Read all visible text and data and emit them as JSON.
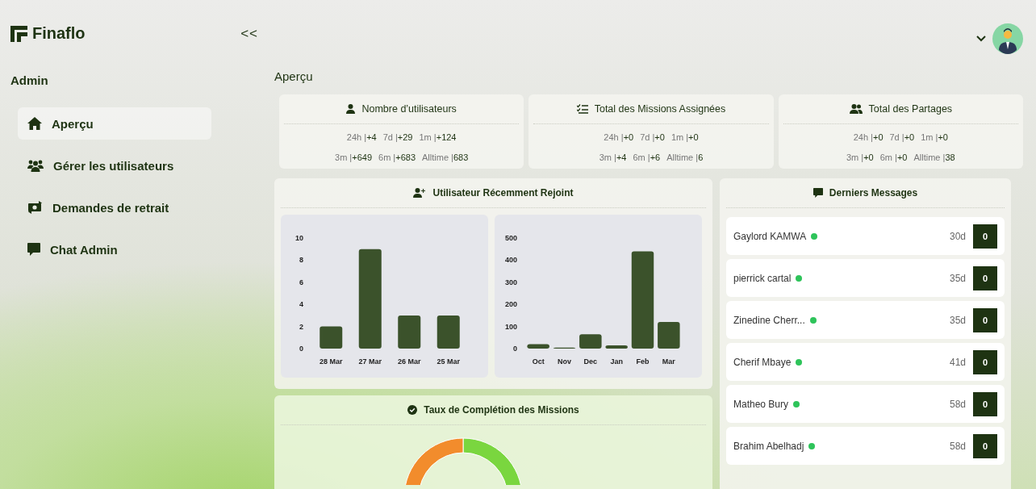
{
  "brand": {
    "name": "Finaflo",
    "collapse": "<<"
  },
  "sidebar": {
    "section": "Admin",
    "items": [
      {
        "label": "Aperçu",
        "selected": true
      },
      {
        "label": "Gérer les utilisateurs",
        "selected": false
      },
      {
        "label": "Demandes de retrait",
        "selected": false
      },
      {
        "label": "Chat Admin",
        "selected": false
      }
    ]
  },
  "page_title": "Aperçu",
  "stats": [
    {
      "title": "Nombre d’utilisateurs",
      "rows": [
        [
          {
            "label": "24h |",
            "value": "+4"
          },
          {
            "label": "7d |",
            "value": "+29"
          },
          {
            "label": "1m |",
            "value": "+124"
          }
        ],
        [
          {
            "label": "3m |",
            "value": "+649"
          },
          {
            "label": "6m |",
            "value": "+683"
          },
          {
            "label": "Alltime |",
            "value": "683"
          }
        ]
      ]
    },
    {
      "title": "Total des Missions Assignées",
      "rows": [
        [
          {
            "label": "24h |",
            "value": "+0"
          },
          {
            "label": "7d |",
            "value": "+0"
          },
          {
            "label": "1m |",
            "value": "+0"
          }
        ],
        [
          {
            "label": "3m |",
            "value": "+4"
          },
          {
            "label": "6m |",
            "value": "+6"
          },
          {
            "label": "Alltime |",
            "value": "6"
          }
        ]
      ]
    },
    {
      "title": "Total des Partages",
      "rows": [
        [
          {
            "label": "24h |",
            "value": "+0"
          },
          {
            "label": "7d |",
            "value": "+0"
          },
          {
            "label": "1m |",
            "value": "+0"
          }
        ],
        [
          {
            "label": "3m |",
            "value": "+0"
          },
          {
            "label": "6m |",
            "value": "+0"
          },
          {
            "label": "Alltime |",
            "value": "38"
          }
        ]
      ]
    }
  ],
  "joined": {
    "title": "Utilisateur Récemment Rejoint",
    "charts": [
      {
        "chart_data": {
          "type": "bar",
          "categories": [
            "28 Mar",
            "27 Mar",
            "26 Mar",
            "25 Mar"
          ],
          "series": [
            {
              "color": "#3b522b",
              "values": [
                2,
                9,
                3,
                3
              ]
            }
          ],
          "ylim": [
            0,
            10
          ],
          "yticks": [
            0,
            2,
            4,
            6,
            8,
            10
          ]
        }
      },
      {
        "chart_data": {
          "type": "bar",
          "categories": [
            "Oct",
            "Nov",
            "Dec",
            "Jan",
            "Feb",
            "Mar"
          ],
          "series": [
            {
              "color": "#3b522b",
              "values": [
                20,
                5,
                65,
                15,
                440,
                120
              ]
            }
          ],
          "ylim": [
            0,
            500
          ],
          "yticks": [
            0,
            100,
            200,
            300,
            400,
            500
          ]
        }
      }
    ]
  },
  "completion": {
    "title": "Taux de Complétion des Missions"
  },
  "messages": {
    "title": "Derniers Messages",
    "items": [
      {
        "name": "Gaylord KAMWA",
        "online": true,
        "time": "30d",
        "count": "0"
      },
      {
        "name": "pierrick cartal",
        "online": true,
        "time": "35d",
        "count": "0"
      },
      {
        "name": "Zinedine Cherr...",
        "online": true,
        "time": "35d",
        "count": "0"
      },
      {
        "name": "Cherif Mbaye",
        "online": true,
        "time": "41d",
        "count": "0"
      },
      {
        "name": "Matheo Bury",
        "online": true,
        "time": "58d",
        "count": "0"
      },
      {
        "name": "Brahim Abelhadj",
        "online": true,
        "time": "58d",
        "count": "0"
      }
    ]
  }
}
